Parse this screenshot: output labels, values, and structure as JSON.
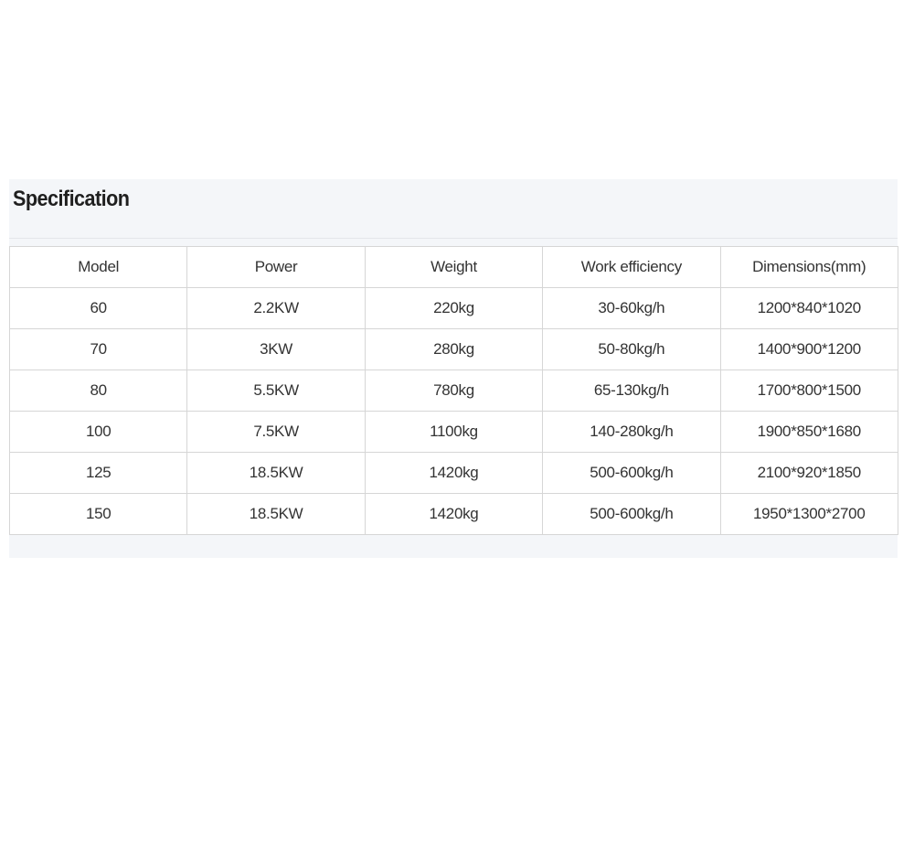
{
  "section": {
    "title": "Specification"
  },
  "table": {
    "headers": [
      "Model",
      "Power",
      "Weight",
      "Work efficiency",
      "Dimensions(mm)"
    ],
    "rows": [
      [
        "60",
        "2.2KW",
        "220kg",
        "30-60kg/h",
        "1200*840*1020"
      ],
      [
        "70",
        "3KW",
        "280kg",
        "50-80kg/h",
        "1400*900*1200"
      ],
      [
        "80",
        "5.5KW",
        "780kg",
        "65-130kg/h",
        "1700*800*1500"
      ],
      [
        "100",
        "7.5KW",
        "1100kg",
        "140-280kg/h",
        "1900*850*1680"
      ],
      [
        "125",
        "18.5KW",
        "1420kg",
        "500-600kg/h",
        "2100*920*1850"
      ],
      [
        "150",
        "18.5KW",
        "1420kg",
        "500-600kg/h",
        "1950*1300*2700"
      ]
    ]
  }
}
